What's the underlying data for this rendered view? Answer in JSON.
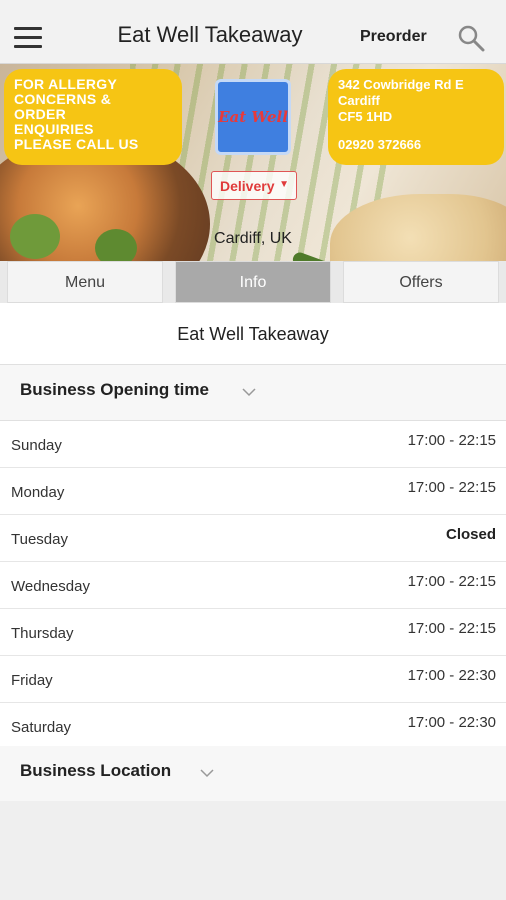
{
  "header": {
    "title": "Eat Well Takeaway",
    "preorder_label": "Preorder",
    "menu_icon": "hamburger-menu-icon",
    "search_icon": "search-icon"
  },
  "banner": {
    "notice_lines": [
      "FOR ALLERGY",
      "CONCERNS &",
      "ORDER",
      "ENQUIRIES",
      "PLEASE CALL US"
    ],
    "address_lines": [
      "342 Cowbridge Rd E",
      "Cardiff",
      "CF5 1HD"
    ],
    "phone": "02920 372666",
    "logo_text": "Eat Well",
    "order_type": "Delivery",
    "location": "Cardiff, UK"
  },
  "tabs": [
    {
      "label": "Menu",
      "active": false
    },
    {
      "label": "Info",
      "active": true
    },
    {
      "label": "Offers",
      "active": false
    }
  ],
  "info": {
    "business_name": "Eat Well Takeaway",
    "opening_section_label": "Business Opening time",
    "location_section_label": "Business Location",
    "hours": [
      {
        "day": "Sunday",
        "time": "17:00 - 22:15"
      },
      {
        "day": "Monday",
        "time": "17:00 - 22:15"
      },
      {
        "day": "Tuesday",
        "time": "Closed"
      },
      {
        "day": "Wednesday",
        "time": "17:00 - 22:15"
      },
      {
        "day": "Thursday",
        "time": "17:00 - 22:15"
      },
      {
        "day": "Friday",
        "time": "17:00 - 22:30"
      },
      {
        "day": "Saturday",
        "time": "17:00 - 22:30"
      }
    ]
  },
  "colors": {
    "accent_yellow": "#f6c514",
    "logo_blue": "#3f7fe0",
    "delivery_red": "#e03a3a",
    "active_tab": "#a9a9a9"
  }
}
